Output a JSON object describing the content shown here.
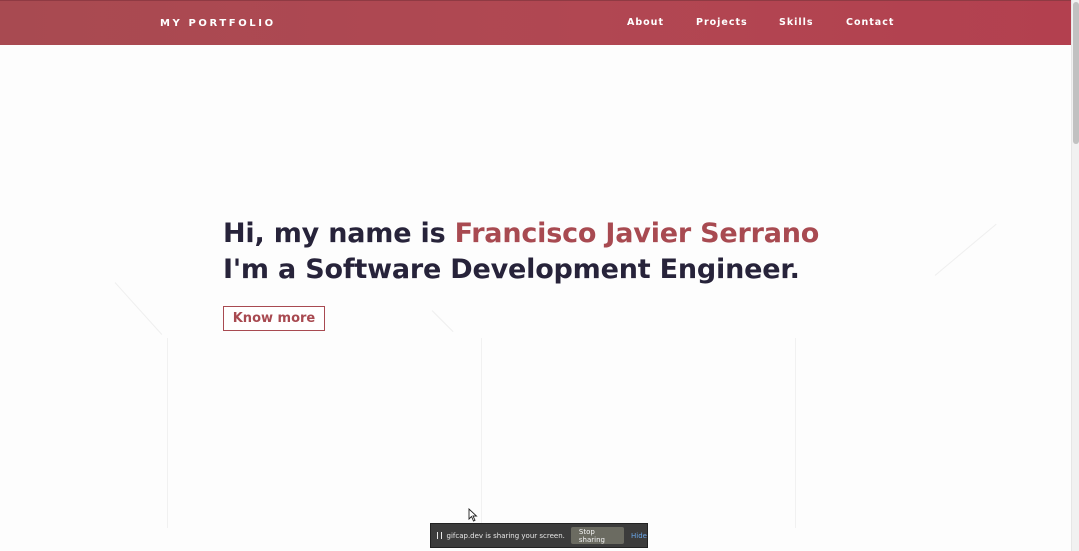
{
  "navbar": {
    "brand": "MY PORTFOLIO",
    "links": [
      "About",
      "Projects",
      "Skills",
      "Contact"
    ],
    "background_color": "#b14752"
  },
  "hero": {
    "greeting": "Hi, my name is",
    "name": "Francisco Javier Serrano",
    "role_line": "I'm a Software Development Engineer.",
    "cta_label": "Know more",
    "accent_color": "#a84a51",
    "text_color": "#27233a"
  },
  "screen_share": {
    "message": "gifcap.dev is sharing your screen.",
    "stop_label": "Stop sharing",
    "hide_label": "Hide"
  },
  "icons": {
    "pause": "pause-icon",
    "cursor": "mouse-cursor-icon"
  }
}
